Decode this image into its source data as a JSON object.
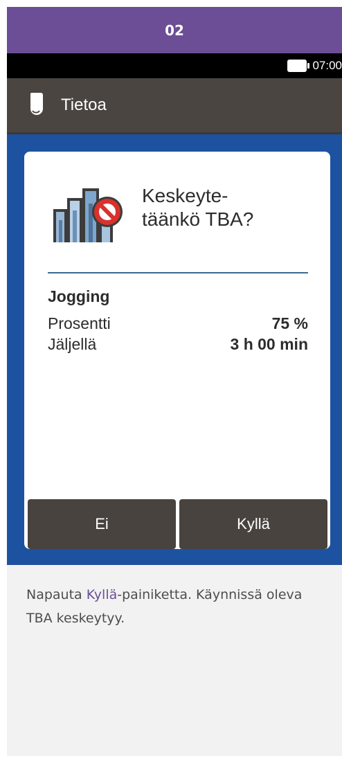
{
  "step": {
    "number": "02"
  },
  "status_bar": {
    "time": "07:00",
    "battery_icon": "battery-full-icon"
  },
  "title_bar": {
    "title": "Tietoa",
    "icon": "info-pump-icon"
  },
  "dialog": {
    "icon": "tba-cancel-icon",
    "question": "Keskeyte-\ntäänkö TBA?",
    "profile_name": "Jogging",
    "rows": [
      {
        "label": "Prosentti",
        "value": "75 %"
      },
      {
        "label": "Jäljellä",
        "value": "3 h 00 min"
      }
    ],
    "buttons": {
      "no": "Ei",
      "yes": "Kyllä"
    }
  },
  "instructions": {
    "prefix": "Napauta ",
    "highlight": "Kyllä",
    "suffix": "-painiketta. Käynnissä oleva TBA keskeytyy."
  },
  "colors": {
    "header_purple": "#6b4e96",
    "blue_background": "#1c52a0",
    "dark_bar": "#4a4541",
    "button": "#48433f",
    "cancel_red": "#d9322c"
  }
}
